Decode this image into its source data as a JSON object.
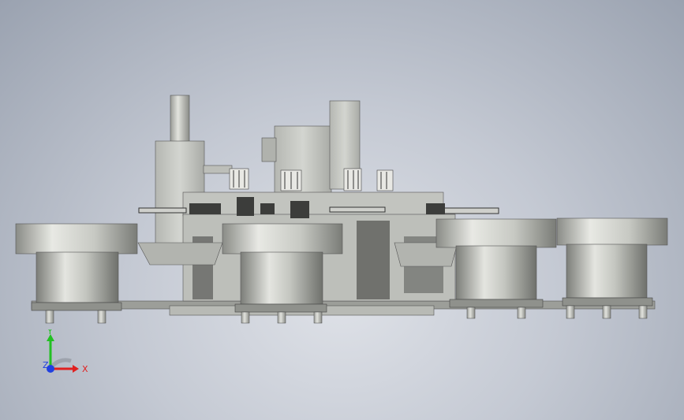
{
  "viewport": {
    "background_center": "#dfe2e8",
    "background_edge": "#9aa2b0"
  },
  "model": {
    "body_color": "#c9cbc6",
    "shade_color": "#8e908c",
    "dark_color": "#3a3b3a",
    "bowl_light": "#e4e5e0",
    "bowl_mid": "#b9bbb5",
    "bowl_dark": "#7c7e79"
  },
  "triad": {
    "x_label": "X",
    "y_label": "Y",
    "z_label": "Z",
    "x_color": "#e02020",
    "y_color": "#22c022",
    "z_color": "#2040e0"
  }
}
